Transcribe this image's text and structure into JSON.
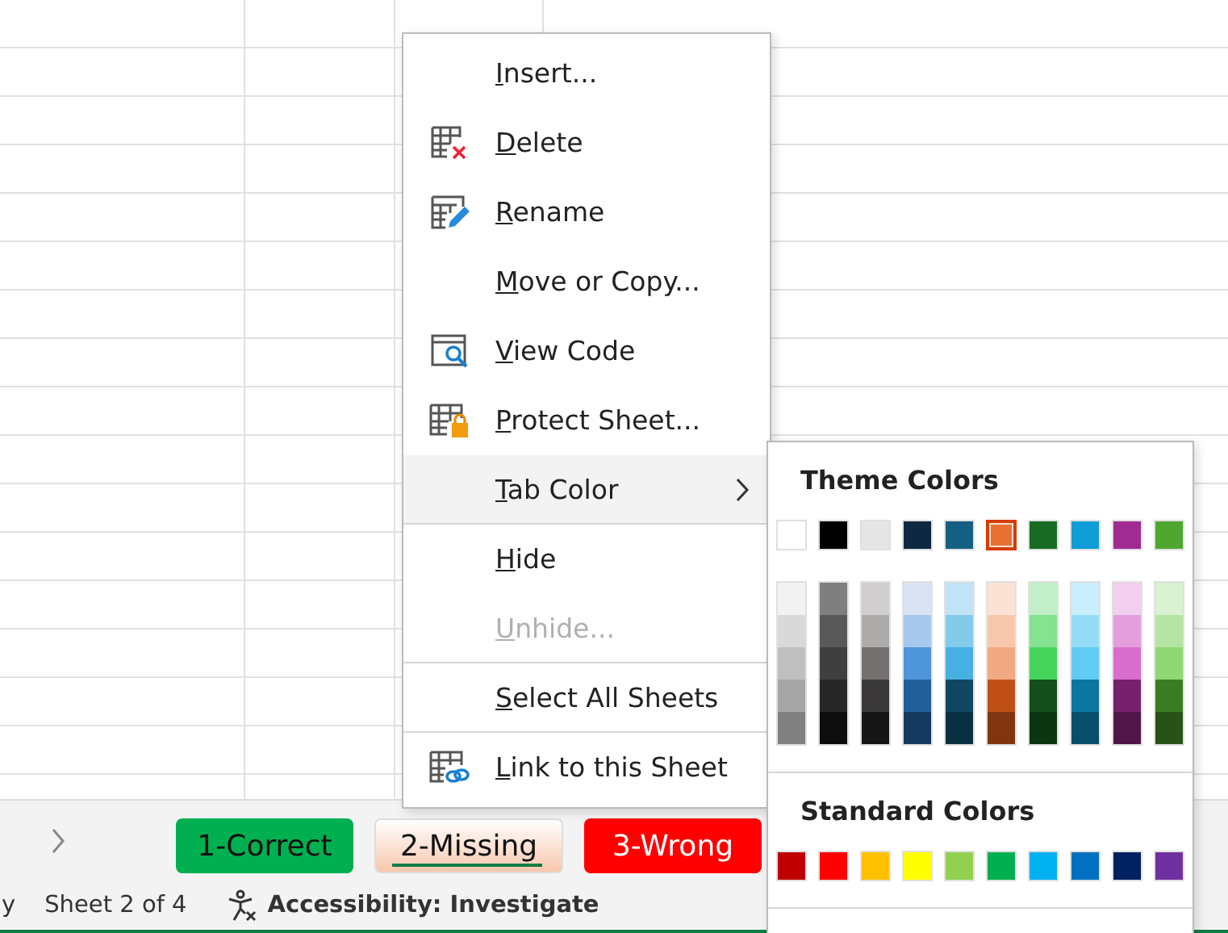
{
  "menu": {
    "items": [
      {
        "label": "Insert...",
        "kind": "item",
        "disabled": false,
        "highlighted": false,
        "separator_below": false
      },
      {
        "label": "Delete",
        "kind": "item",
        "disabled": false,
        "highlighted": false,
        "separator_below": false
      },
      {
        "label": "Rename",
        "kind": "item",
        "disabled": false,
        "highlighted": false,
        "separator_below": false
      },
      {
        "label": "Move or Copy...",
        "kind": "item",
        "disabled": false,
        "highlighted": false,
        "separator_below": false
      },
      {
        "label": "View Code",
        "kind": "item",
        "disabled": false,
        "highlighted": false,
        "separator_below": false
      },
      {
        "label": "Protect Sheet...",
        "kind": "item",
        "disabled": false,
        "highlighted": false,
        "separator_below": false
      },
      {
        "label": "Tab Color",
        "kind": "submenu",
        "disabled": false,
        "highlighted": true,
        "separator_below": true
      },
      {
        "label": "Hide",
        "kind": "item",
        "disabled": false,
        "highlighted": false,
        "separator_below": false
      },
      {
        "label": "Unhide...",
        "kind": "item",
        "disabled": true,
        "highlighted": false,
        "separator_below": true
      },
      {
        "label": "Select All Sheets",
        "kind": "item",
        "disabled": false,
        "highlighted": false,
        "separator_below": true
      },
      {
        "label": "Link to this Sheet",
        "kind": "item",
        "disabled": false,
        "highlighted": false,
        "separator_below": false
      }
    ]
  },
  "submenu": {
    "theme_title": "Theme Colors",
    "theme_colors": [
      {
        "color": "#ffffff",
        "selected": false
      },
      {
        "color": "#000000",
        "selected": false
      },
      {
        "color": "#e7e6e6",
        "selected": false
      },
      {
        "color": "#0e2841",
        "selected": false
      },
      {
        "color": "#156082",
        "selected": false
      },
      {
        "color": "#e97132",
        "selected": true
      },
      {
        "color": "#196b24",
        "selected": false
      },
      {
        "color": "#0f9ed5",
        "selected": false
      },
      {
        "color": "#a02b93",
        "selected": false
      },
      {
        "color": "#4ea72e",
        "selected": false
      }
    ],
    "shades": [
      {
        "tints": [
          {
            "color": "#f2f2f2"
          },
          {
            "color": "#d9d9d9"
          },
          {
            "color": "#bfbfbf"
          },
          {
            "color": "#a6a6a6"
          },
          {
            "color": "#808080"
          }
        ]
      },
      {
        "tints": [
          {
            "color": "#7f7f7f"
          },
          {
            "color": "#595959"
          },
          {
            "color": "#3f3f3f"
          },
          {
            "color": "#262626"
          },
          {
            "color": "#0d0d0d"
          }
        ]
      },
      {
        "tints": [
          {
            "color": "#d0cece"
          },
          {
            "color": "#aeabab"
          },
          {
            "color": "#757070"
          },
          {
            "color": "#3a3838"
          },
          {
            "color": "#171616"
          }
        ]
      },
      {
        "tints": [
          {
            "color": "#dae3f3"
          },
          {
            "color": "#a6c8ec"
          },
          {
            "color": "#4e95d9"
          },
          {
            "color": "#215f9a"
          },
          {
            "color": "#163a5f"
          }
        ]
      },
      {
        "tints": [
          {
            "color": "#c0e4f5"
          },
          {
            "color": "#83cbeb"
          },
          {
            "color": "#45b0e1"
          },
          {
            "color": "#0f4761"
          },
          {
            "color": "#0a2f40"
          }
        ]
      },
      {
        "tints": [
          {
            "color": "#fbe2d5"
          },
          {
            "color": "#f7c7ac"
          },
          {
            "color": "#f1a983"
          },
          {
            "color": "#c04f15"
          },
          {
            "color": "#803510"
          }
        ]
      },
      {
        "tints": [
          {
            "color": "#c1f0c8"
          },
          {
            "color": "#84e291"
          },
          {
            "color": "#47d45a"
          },
          {
            "color": "#124f1a"
          },
          {
            "color": "#0c3511"
          }
        ]
      },
      {
        "tints": [
          {
            "color": "#caeefb"
          },
          {
            "color": "#95ddf7"
          },
          {
            "color": "#61cbf3"
          },
          {
            "color": "#0b76a0"
          },
          {
            "color": "#074f6a"
          }
        ]
      },
      {
        "tints": [
          {
            "color": "#f2ceef"
          },
          {
            "color": "#e59edd"
          },
          {
            "color": "#d86dcd"
          },
          {
            "color": "#77206d"
          },
          {
            "color": "#501549"
          }
        ]
      },
      {
        "tints": [
          {
            "color": "#d9f2d0"
          },
          {
            "color": "#b4e5a2"
          },
          {
            "color": "#8ed973"
          },
          {
            "color": "#3b7d23"
          },
          {
            "color": "#275317"
          }
        ]
      }
    ],
    "standard_title": "Standard Colors",
    "standard_colors": [
      {
        "color": "#c00000",
        "selected": false
      },
      {
        "color": "#ff0000",
        "selected": false
      },
      {
        "color": "#ffc000",
        "selected": false
      },
      {
        "color": "#ffff00",
        "selected": false
      },
      {
        "color": "#92d050",
        "selected": false
      },
      {
        "color": "#00b050",
        "selected": false
      },
      {
        "color": "#00b0f0",
        "selected": false
      },
      {
        "color": "#0070c0",
        "selected": false
      },
      {
        "color": "#002060",
        "selected": false
      },
      {
        "color": "#7030a0",
        "selected": false
      }
    ]
  },
  "sheet_tabs": [
    {
      "label": "1-Correct",
      "color": "#00b050",
      "selected": false
    },
    {
      "label": "2-Missing",
      "color": "#f7c7ac",
      "selected": true
    },
    {
      "label": "3-Wrong",
      "color": "#ff0000",
      "selected": false
    }
  ],
  "status_bar": {
    "mode": "y",
    "sheet": "Sheet 2 of 4",
    "accessibility": "Accessibility: Investigate"
  }
}
